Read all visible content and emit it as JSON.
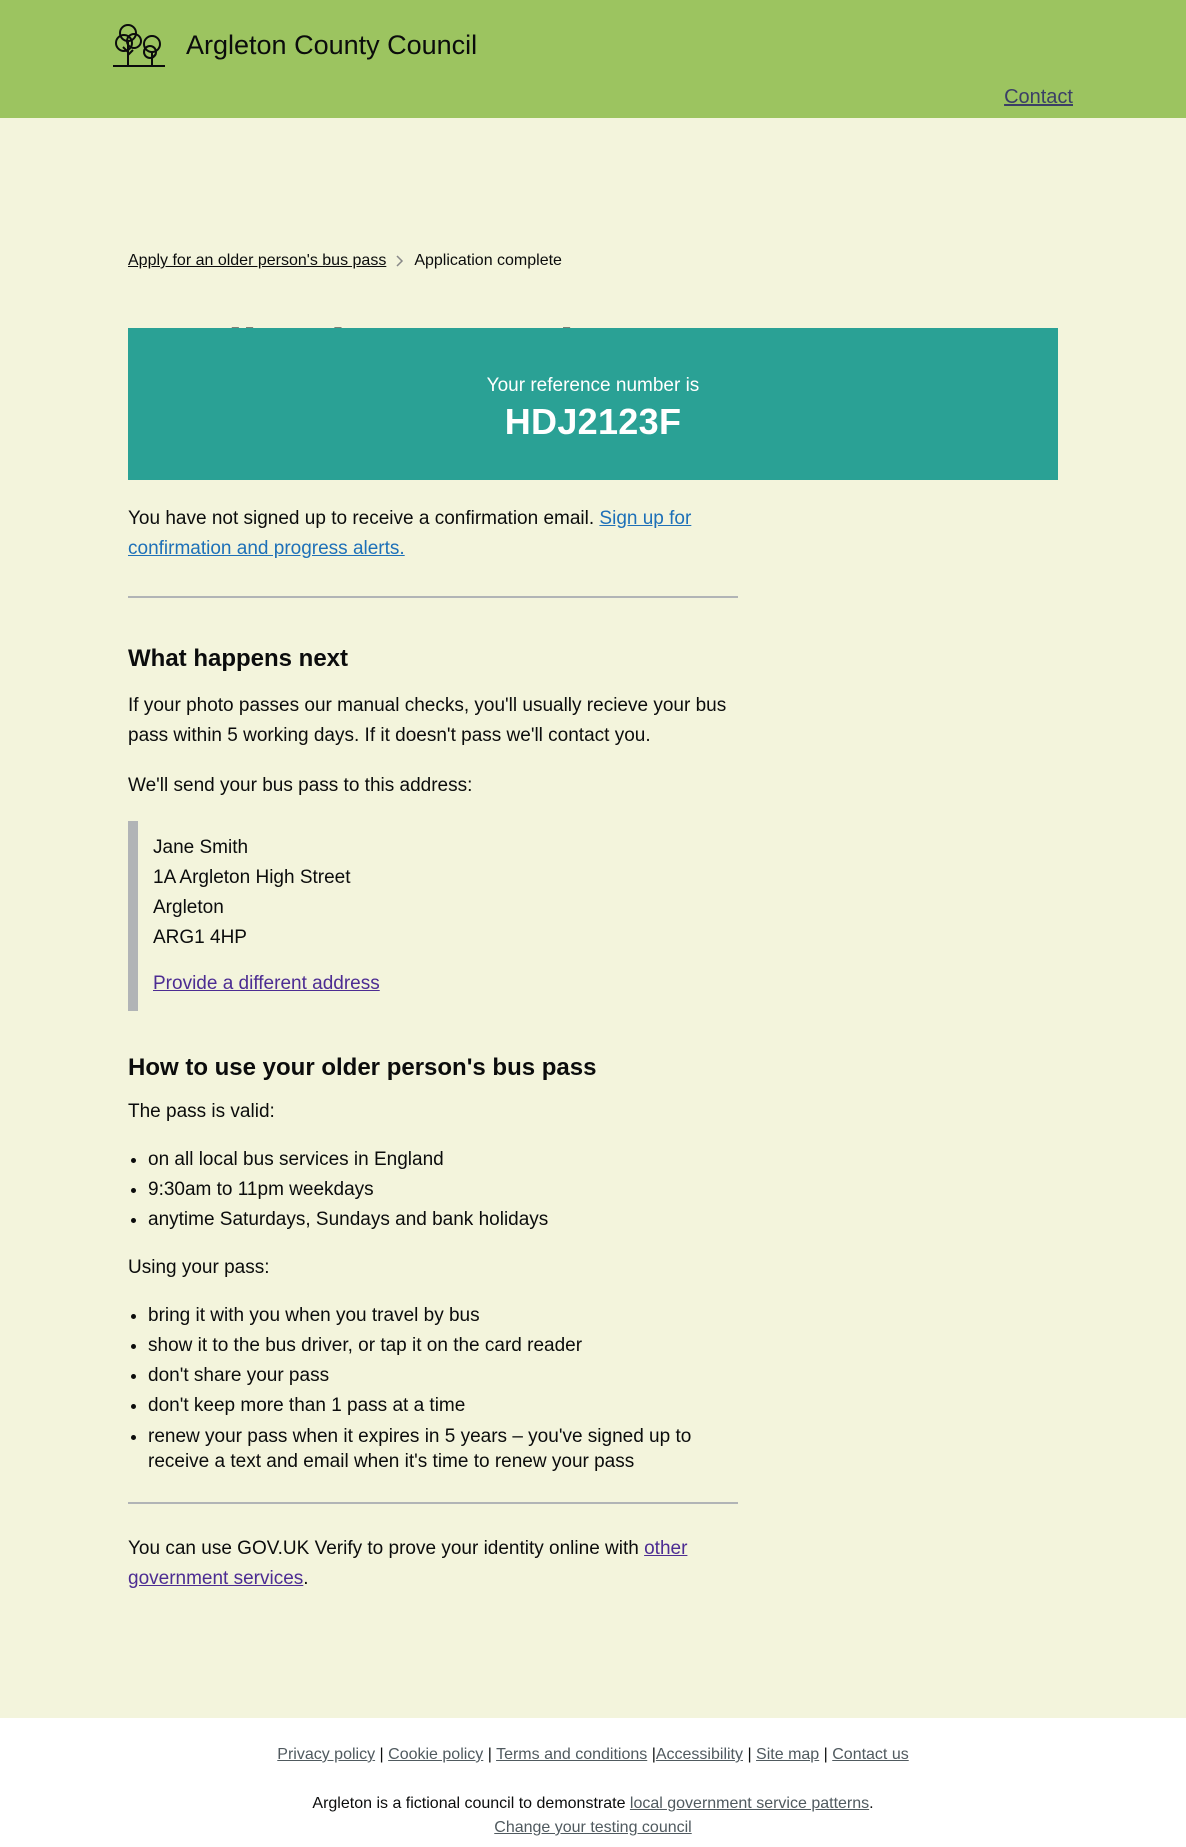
{
  "header": {
    "council_name": "Argleton County Council",
    "contact_label": "Contact",
    "logo_icon": "trees-icon"
  },
  "breadcrumb": {
    "parent_label": "Apply for an older person's bus pass",
    "current_label": "Application complete"
  },
  "page_title": "Application complete",
  "confirmation_panel": {
    "label": "Your reference number is",
    "reference": "HDJ2123F",
    "color": "#2aa195"
  },
  "email_notice": {
    "text": "You have not signed up to receive a confirmation email. ",
    "link_label": "Sign up for confirmation and progress alerts."
  },
  "what_happens_next": {
    "heading": "What happens next",
    "paragraph": "If your photo passes our manual checks, you'll usually recieve your bus pass within 5 working days. If it doesn't pass we'll contact you.",
    "address_intro": "We'll send your bus pass to this address:",
    "address": {
      "name": "Jane Smith",
      "line1": "1A Argleton High Street",
      "town": "Argleton",
      "postcode": "ARG1 4HP"
    },
    "change_address_label": "Provide a different address"
  },
  "how_to_use": {
    "heading": "How to use your older person's bus pass",
    "valid_intro": "The pass is valid:",
    "valid_items": [
      "on all local bus services in England",
      "9:30am to 11pm weekdays",
      "anytime Saturdays, Sundays and bank holidays"
    ],
    "using_intro": "Using your pass:",
    "using_items": [
      "bring it with you when you travel by bus",
      "show it to the bus driver, or tap it on the card reader",
      "don't share your pass",
      "don't keep more than 1 pass at a time",
      "renew your pass when it expires in 5 years – you've signed up to receive a text and email when it's time to renew your pass"
    ]
  },
  "verify": {
    "text": "You can use GOV.UK Verify to prove your identity online with ",
    "link_label": "other government services",
    "end": "."
  },
  "footer": {
    "links": [
      "Privacy policy",
      "Cookie policy",
      "Terms and conditions",
      "Accessibility",
      "Site map",
      "Contact us"
    ],
    "note_text": "Argleton is a fictional council to demonstrate ",
    "note_link": "local government service patterns",
    "note_end": ".",
    "change_council_label": "Change your testing council"
  }
}
